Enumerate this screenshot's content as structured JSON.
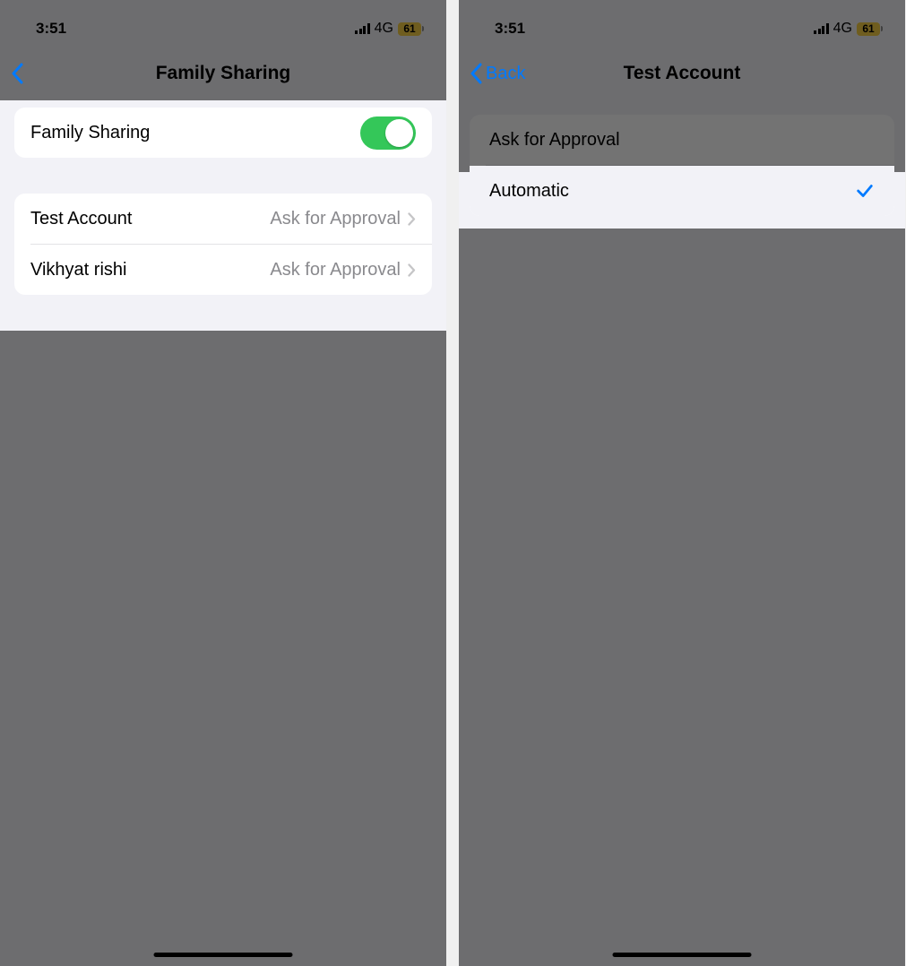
{
  "screen1": {
    "status": {
      "time": "3:51",
      "network": "4G",
      "battery": "61"
    },
    "nav": {
      "title": "Family Sharing"
    },
    "toggle_row": {
      "label": "Family Sharing",
      "on": true
    },
    "members": [
      {
        "name": "Test Account",
        "status": "Ask for Approval"
      },
      {
        "name": "Vikhyat rishi",
        "status": "Ask for Approval"
      }
    ]
  },
  "screen2": {
    "status": {
      "time": "3:51",
      "network": "4G",
      "battery": "61"
    },
    "nav": {
      "back": "Back",
      "title": "Test Account"
    },
    "options": [
      {
        "label": "Ask for Approval",
        "selected": false
      },
      {
        "label": "Automatic",
        "selected": true
      }
    ]
  }
}
